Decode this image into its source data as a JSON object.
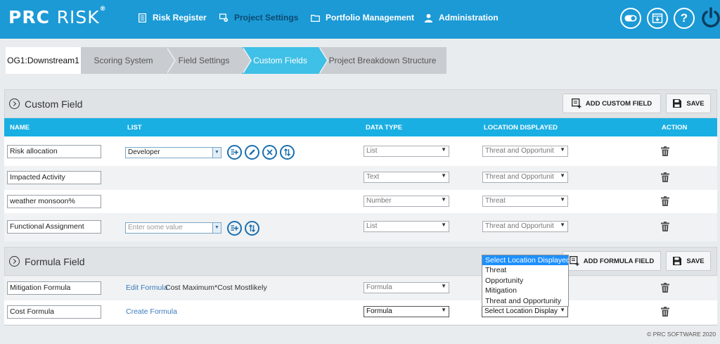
{
  "app": {
    "logo_bold": "PRC",
    "logo_thin": "RISK",
    "logo_mark": "®"
  },
  "nav": [
    {
      "label": "Risk Register",
      "icon": "register-icon"
    },
    {
      "label": "Project Settings",
      "icon": "settings-icon",
      "active": true
    },
    {
      "label": "Portfolio Management",
      "icon": "folder-icon"
    },
    {
      "label": "Administration",
      "icon": "user-icon"
    }
  ],
  "top_icons": [
    "toggle-icon",
    "download-icon",
    "help-icon",
    "power-icon"
  ],
  "help_glyph": "?",
  "breadcrumb": {
    "project": "OG1:Downstream1",
    "steps": [
      "Scoring System",
      "Field Settings",
      "Custom Fields",
      "Project Breakdown Structure"
    ],
    "active_step": "Custom Fields"
  },
  "custom_field": {
    "title": "Custom Field",
    "add_label": "ADD CUSTOM FIELD",
    "save_label": "SAVE",
    "columns": {
      "name": "NAME",
      "list": "LIST",
      "data_type": "DATA TYPE",
      "location": "LOCATION DISPLAYED",
      "action": "ACTION"
    },
    "rows": [
      {
        "name": "Risk allocation",
        "list": "Developer",
        "data_type": "List",
        "location": "Threat and Opportunit"
      },
      {
        "name": "Impacted Activity",
        "data_type": "Text",
        "location": "Threat and Opportunit"
      },
      {
        "name": "weather monsoon%",
        "data_type": "Number",
        "location": "Threat"
      },
      {
        "name": "Functional Assignment",
        "list_placeholder": "Enter some value",
        "data_type": "List",
        "location": "Threat and Opportunit"
      }
    ]
  },
  "formula_field": {
    "title": "Formula Field",
    "add_label": "ADD FORMULA FIELD",
    "save_label": "SAVE",
    "rows": [
      {
        "name": "Mitigation Formula",
        "link": "Edit Formula",
        "formula": "Cost Maximum*Cost Mostlikely",
        "data_type": "Formula"
      },
      {
        "name": "Cost Formula",
        "link": "Create Formula",
        "data_type": "Formula",
        "location": "Select Location Display"
      }
    ],
    "location_options": [
      "Select Location Displayed",
      "Threat",
      "Opportunity",
      "Mitigation",
      "Threat and Opportunity"
    ],
    "location_selected": "Select Location Displayed"
  },
  "footer": "© PRC SOFTWARE 2020",
  "colors": {
    "topbar": "#1c9ad6",
    "accent": "#1aafe3",
    "active_crumb": "#3fc0e6"
  }
}
